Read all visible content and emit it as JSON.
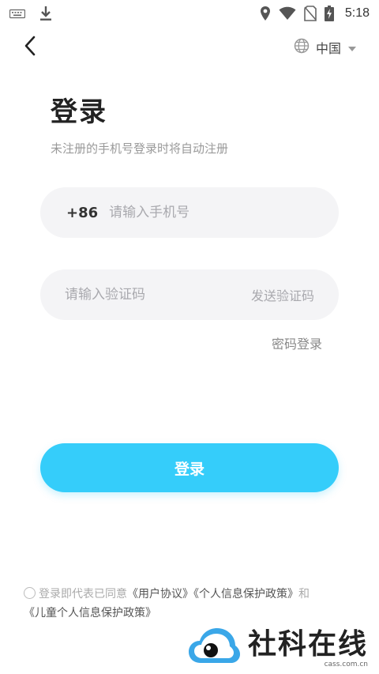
{
  "status_bar": {
    "time": "5:18",
    "icons": [
      "keyboard-icon",
      "download-icon",
      "location-icon",
      "wifi-icon",
      "no-sim-icon",
      "battery-charging-icon"
    ]
  },
  "header": {
    "back_icon": "chevron-left-icon",
    "region_icon": "globe-icon",
    "region_label": "中国",
    "region_dropdown_icon": "caret-down-icon"
  },
  "main": {
    "title": "登录",
    "subtitle": "未注册的手机号登录时将自动注册",
    "phone": {
      "country_code": "+86",
      "placeholder": "请输入手机号",
      "value": ""
    },
    "code": {
      "placeholder": "请输入验证码",
      "value": "",
      "send_label": "发送验证码"
    },
    "password_login_label": "密码登录",
    "login_button_label": "登录"
  },
  "agreement": {
    "prefix": "登录即代表已同意",
    "user_agreement": "《用户协议》",
    "privacy_policy": "《个人信息保护政策》",
    "and": "和",
    "children_policy": "《儿童个人信息保护政策》"
  },
  "watermark": {
    "text": "社科在线",
    "url": "cass.com.cn"
  },
  "colors": {
    "accent": "#35cdfa",
    "field_bg": "#f4f4f6",
    "placeholder": "#a9a9ae"
  }
}
